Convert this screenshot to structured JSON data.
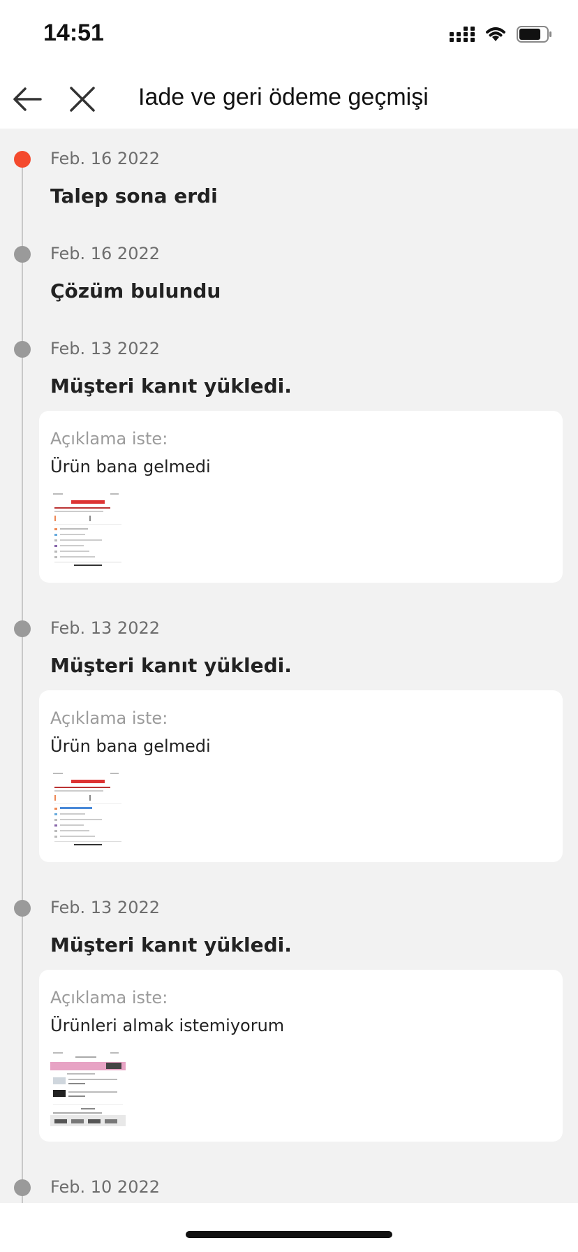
{
  "status_bar": {
    "time": "14:51"
  },
  "nav": {
    "title": "Iade ve geri ödeme geçmişi"
  },
  "events": [
    {
      "date": "Feb. 16 2022",
      "title": "Talep sona erdi",
      "active": true
    },
    {
      "date": "Feb. 16 2022",
      "title": "Çözüm bulundu"
    },
    {
      "date": "Feb. 13 2022",
      "title": "Müşteri kanıt yükledi.",
      "card": {
        "label": "Açıklama iste:",
        "text": "Ürün bana gelmedi"
      }
    },
    {
      "date": "Feb. 13 2022",
      "title": "Müşteri kanıt yükledi.",
      "card": {
        "label": "Açıklama iste:",
        "text": "Ürün bana gelmedi"
      }
    },
    {
      "date": "Feb. 13 2022",
      "title": "Müşteri kanıt yükledi.",
      "card": {
        "label": "Açıklama iste:",
        "text": "Ürünleri almak istemiyorum"
      }
    },
    {
      "date": "Feb. 10 2022"
    }
  ],
  "colors": {
    "accent": "#f44a2d",
    "inactive_dot": "#9a9a9a",
    "background": "#f2f2f2"
  }
}
